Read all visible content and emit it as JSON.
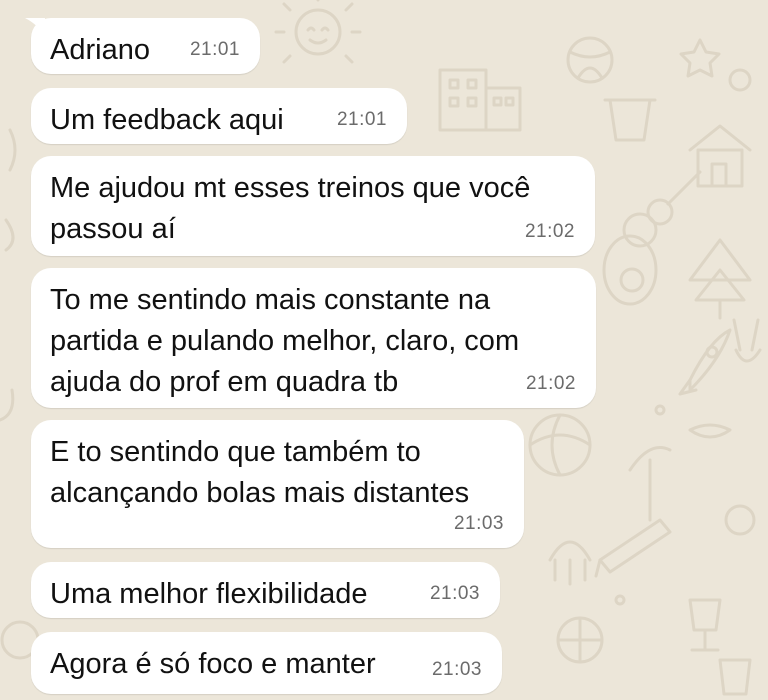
{
  "colors": {
    "wallpaper": "#ece6d9",
    "doodle": "#ddd5c5",
    "bubble": "#ffffff",
    "text": "#111111",
    "timestamp": "#6b6b6b"
  },
  "messages": [
    {
      "text": "Adriano",
      "time": "21:01"
    },
    {
      "text": "Um feedback aqui",
      "time": "21:01"
    },
    {
      "text": "Me ajudou mt esses treinos que você\npassou aí",
      "time": "21:02"
    },
    {
      "text": "To me sentindo mais constante na\npartida e pulando melhor, claro, com\najuda do prof em quadra tb",
      "time": "21:02"
    },
    {
      "text": "E to sentindo que também to\nalcançando bolas mais distantes",
      "time": "21:03"
    },
    {
      "text": "Uma melhor flexibilidade",
      "time": "21:03"
    },
    {
      "text": "Agora é só foco e manter",
      "time": "21:03"
    }
  ]
}
